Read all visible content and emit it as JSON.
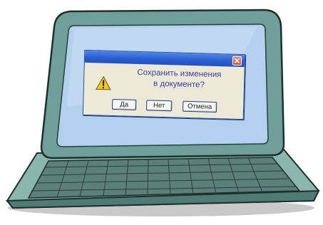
{
  "dialog": {
    "message_line1": "Сохранить изменения",
    "message_line2": "в документе?",
    "buttons": {
      "yes": "Да",
      "no": "Нет",
      "cancel": "Отмена"
    }
  },
  "icons": {
    "close": "close-icon",
    "warning": "warning-icon"
  },
  "colors": {
    "laptop_body": "#6e9f98",
    "screen": "#b3d1ee",
    "titlebar": "#2a5ed1",
    "close_button": "#d5502c",
    "dialog_bg": "#ece9d8",
    "warning": "#f5c518"
  }
}
